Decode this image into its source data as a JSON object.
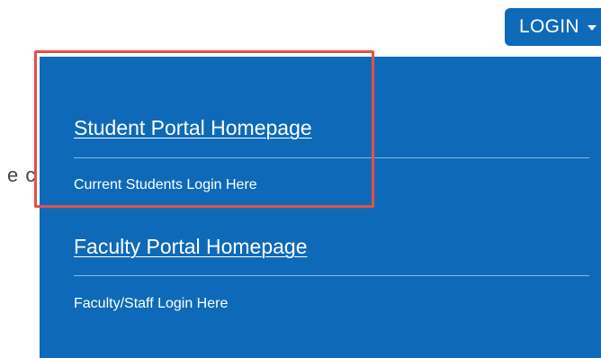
{
  "header": {
    "login_label": "LOGIN",
    "caret_icon": "caret-down-icon"
  },
  "background": {
    "partial_text": "e c"
  },
  "dropdown": {
    "items": [
      {
        "link_label": "Student Portal Homepage",
        "description": "Current Students Login Here"
      },
      {
        "link_label": "Faculty Portal Homepage",
        "description": "Faculty/Staff Login Here"
      }
    ]
  },
  "colors": {
    "accent": "#0e6ab8",
    "highlight": "#e0524a",
    "divider": "#8fb8de"
  }
}
